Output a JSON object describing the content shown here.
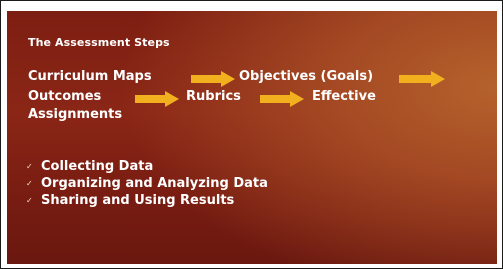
{
  "slide": {
    "title": "The Assessment Steps",
    "flow": {
      "curriculum_maps": "Curriculum Maps",
      "objectives": "Objectives (Goals)",
      "outcomes": "Outcomes",
      "rubrics": "Rubrics",
      "effective": "Effective",
      "assignments": "Assignments"
    },
    "bullets": [
      "Collecting Data",
      "Organizing and Analyzing Data",
      "Sharing and Using Results"
    ],
    "bullet_icon": "checkmark-icon",
    "colors": {
      "background": "#8a2616",
      "text": "#ffffff",
      "arrow": "#f2b01e"
    }
  }
}
